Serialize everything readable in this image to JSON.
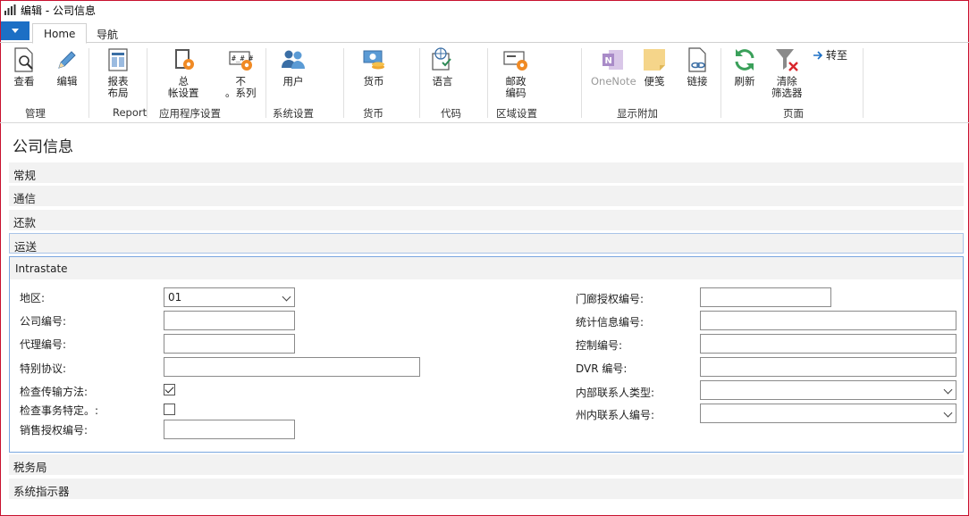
{
  "window": {
    "title": "编辑 - 公司信息"
  },
  "tabs": [
    {
      "label": "Home"
    },
    {
      "label": "导航"
    }
  ],
  "ribbon": {
    "buttons": [
      {
        "label": "查看"
      },
      {
        "label": "编辑"
      },
      {
        "label": "报表\n布局"
      },
      {
        "label": "总\n帐设置"
      },
      {
        "label": "不\n。系列"
      },
      {
        "label": "用户"
      },
      {
        "label": "货币"
      },
      {
        "label": "语言"
      },
      {
        "label": "邮政\n编码"
      },
      {
        "label": "OneNote"
      },
      {
        "label": "便笺"
      },
      {
        "label": "链接"
      },
      {
        "label": "刷新"
      },
      {
        "label": "清除\n筛选器"
      }
    ],
    "goto_label": "转至",
    "groups": [
      "管理",
      "Report",
      "应用程序设置",
      "系统设置",
      "货币",
      "代码",
      "区域设置",
      "显示附加",
      "页面"
    ]
  },
  "page": {
    "title": "公司信息",
    "fasttabs_top": [
      "常规",
      "通信",
      "还款",
      "运送"
    ],
    "fasttabs_bottom": [
      "税务局",
      "系统指示器"
    ]
  },
  "intrastate": {
    "title": "Intrastate",
    "left": {
      "area_label": "地区:",
      "area_value": "01",
      "company_no_label": "公司编号:",
      "company_no_value": "",
      "agent_no_label": "代理编号:",
      "agent_no_value": "",
      "special_label": "特别协议:",
      "special_value": "",
      "check_transport_label": "检查传输方法:",
      "check_transport_checked": true,
      "check_txn_label": "检查事务特定。:",
      "check_txn_checked": false,
      "sales_auth_label": "销售授权编号:",
      "sales_auth_value": ""
    },
    "right": {
      "purchase_auth_label": "门廊授权编号:",
      "purchase_auth_value": "",
      "stat_info_label": "统计信息编号:",
      "stat_info_value": "",
      "control_label": "控制编号:",
      "control_value": "",
      "dvr_label": "DVR 编号:",
      "dvr_value": "",
      "internal_contact_type_label": "内部联系人类型:",
      "internal_contact_type_value": "",
      "state_contact_label": "州内联系人编号:",
      "state_contact_value": ""
    }
  }
}
